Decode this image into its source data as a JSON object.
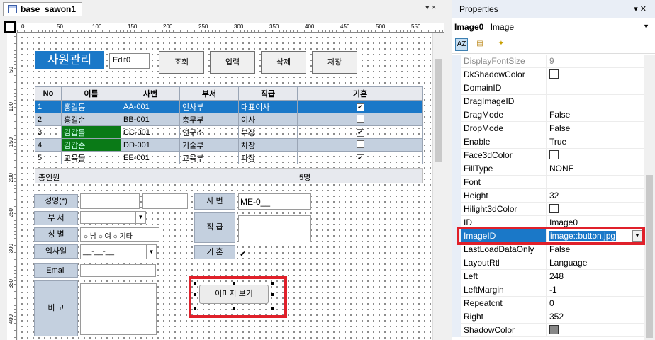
{
  "designer": {
    "tab_title": "base_sawon1",
    "tab_controls": "▾ ×",
    "ruler_top": [
      "0",
      "50",
      "100",
      "150",
      "200",
      "250",
      "300",
      "350",
      "400",
      "450",
      "500",
      "550"
    ],
    "ruler_left": [
      "50",
      "100",
      "150",
      "200",
      "250",
      "300",
      "350",
      "400"
    ]
  },
  "form": {
    "title": "사원관리",
    "edit0": "Edit0",
    "buttons": [
      "조회",
      "입력",
      "삭제",
      "저장"
    ],
    "grid": {
      "headers": [
        "No",
        "이름",
        "사번",
        "부서",
        "직급",
        "기혼"
      ],
      "rows": [
        {
          "no": "1",
          "name": "홍길동",
          "id": "AA-001",
          "dept": "인사부",
          "rank": "대표이사",
          "married": "✔"
        },
        {
          "no": "2",
          "name": "홍길순",
          "id": "BB-001",
          "dept": "총무부",
          "rank": "이사",
          "married": ""
        },
        {
          "no": "3",
          "name": "김갑돌",
          "id": "CC-001",
          "dept": "연구소",
          "rank": "부장",
          "married": "✔"
        },
        {
          "no": "4",
          "name": "김갑순",
          "id": "DD-001",
          "dept": "기술부",
          "rank": "차장",
          "married": ""
        },
        {
          "no": "5",
          "name": "교육돌",
          "id": "EE-001",
          "dept": "교육부",
          "rank": "과장",
          "married": "✔"
        }
      ],
      "footer_label": "총인원",
      "footer_count": "5명"
    },
    "labels": {
      "name": "성명(*)",
      "dept": "부  서",
      "gender": "성  별",
      "join_date": "입사일",
      "email": "Email",
      "note": "비  고",
      "emp_no": "사  번",
      "rank": "직  급",
      "married": "기  혼"
    },
    "gender_options": [
      "남",
      "여",
      "기타"
    ],
    "emp_no_value": "ME-0__",
    "join_date_value": "__-__-__",
    "married_value": "✔",
    "image_button": "이미지 보기"
  },
  "properties": {
    "title": "Properties",
    "pin": "▾ ✕",
    "object_name": "Image0",
    "object_type": "Image",
    "rows": [
      {
        "name": "DisplayFontSize",
        "value": "9",
        "muted": true
      },
      {
        "name": "DkShadowColor",
        "value": "",
        "box": "white"
      },
      {
        "name": "DomainID",
        "value": ""
      },
      {
        "name": "DragImageID",
        "value": ""
      },
      {
        "name": "DragMode",
        "value": "False"
      },
      {
        "name": "DropMode",
        "value": "False"
      },
      {
        "name": "Enable",
        "value": "True"
      },
      {
        "name": "Face3dColor",
        "value": "",
        "box": "white"
      },
      {
        "name": "FillType",
        "value": "NONE"
      },
      {
        "name": "Font",
        "value": ""
      },
      {
        "name": "Height",
        "value": "32"
      },
      {
        "name": "Hilight3dColor",
        "value": "",
        "box": "white"
      },
      {
        "name": "ID",
        "value": "Image0"
      },
      {
        "name": "ImageID",
        "value": "image::button.jpg",
        "selected": true
      },
      {
        "name": "LastLoadDataOnly",
        "value": "False"
      },
      {
        "name": "LayoutRtl",
        "value": "Language"
      },
      {
        "name": "Left",
        "value": "248"
      },
      {
        "name": "LeftMargin",
        "value": "-1"
      },
      {
        "name": "Repeatcnt",
        "value": "0"
      },
      {
        "name": "Right",
        "value": "352"
      },
      {
        "name": "ShadowColor",
        "value": "",
        "box": "gray"
      }
    ]
  }
}
